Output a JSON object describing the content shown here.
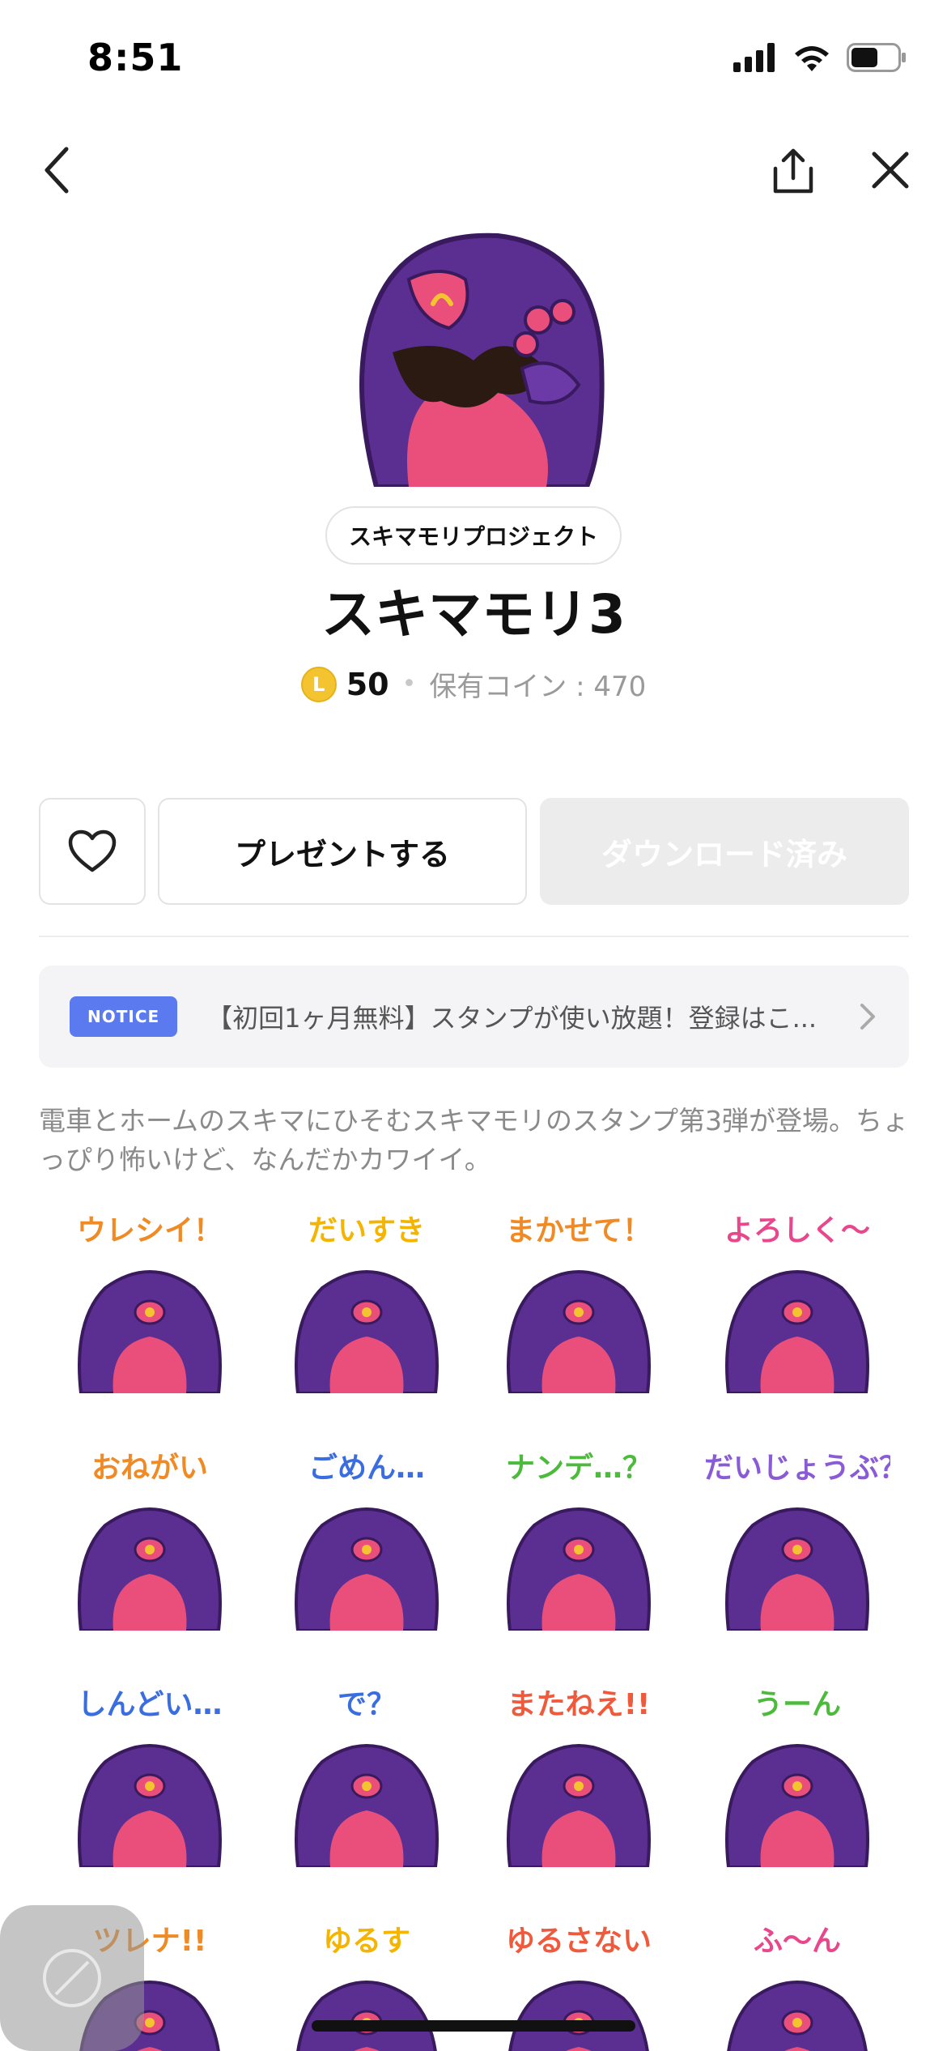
{
  "status_bar": {
    "time": "8:51"
  },
  "nav": {
    "back_icon": "chevron-left-icon",
    "share_icon": "share-icon",
    "close_icon": "close-icon"
  },
  "pack": {
    "author": "スキマモリプロジェクト",
    "title": "スキマモリ3",
    "coin_letter": "L",
    "price": "50",
    "owned_coins": "保有コイン : 470"
  },
  "actions": {
    "like_icon": "heart-icon",
    "present_label": "プレゼントする",
    "download_label": "ダウンロード済み"
  },
  "notice": {
    "badge": "NOTICE",
    "text": "【初回1ヶ月無料】スタンプが使い放題！登録はこ..."
  },
  "description": "電車とホームのスキマにひそむスキマモリのスタンプ第3弾が登場。ちょっぴり怖いけど、なんだかカワイイ。",
  "stickers": [
    {
      "caption": "ウレシイ！",
      "color": "#f08a24"
    },
    {
      "caption": "だいすき",
      "color": "#f4b400"
    },
    {
      "caption": "まかせて！",
      "color": "#f08a24"
    },
    {
      "caption": "よろしく〜",
      "color": "#e8478b"
    },
    {
      "caption": "おねがい",
      "color": "#f08a24"
    },
    {
      "caption": "ごめん…",
      "color": "#3a6de0"
    },
    {
      "caption": "ナンデ…？",
      "color": "#4cbb3c"
    },
    {
      "caption": "だいじょうぶ？",
      "color": "#8a5bd6"
    },
    {
      "caption": "しんどい…",
      "color": "#3a6de0"
    },
    {
      "caption": "で？",
      "color": "#3a6de0"
    },
    {
      "caption": "またねえ!!",
      "color": "#f05a3c"
    },
    {
      "caption": "うーん",
      "color": "#4cbb3c"
    },
    {
      "caption": "ツレナ!!",
      "color": "#f08a24"
    },
    {
      "caption": "ゆるす",
      "color": "#f4b400"
    },
    {
      "caption": "ゆるさない",
      "color": "#f05a3c"
    },
    {
      "caption": "ふ〜ん",
      "color": "#e8478b"
    }
  ],
  "colors": {
    "body_purple": "#5b2e91",
    "body_pink": "#e94f7a",
    "accent_blue": "#5b7af0"
  }
}
